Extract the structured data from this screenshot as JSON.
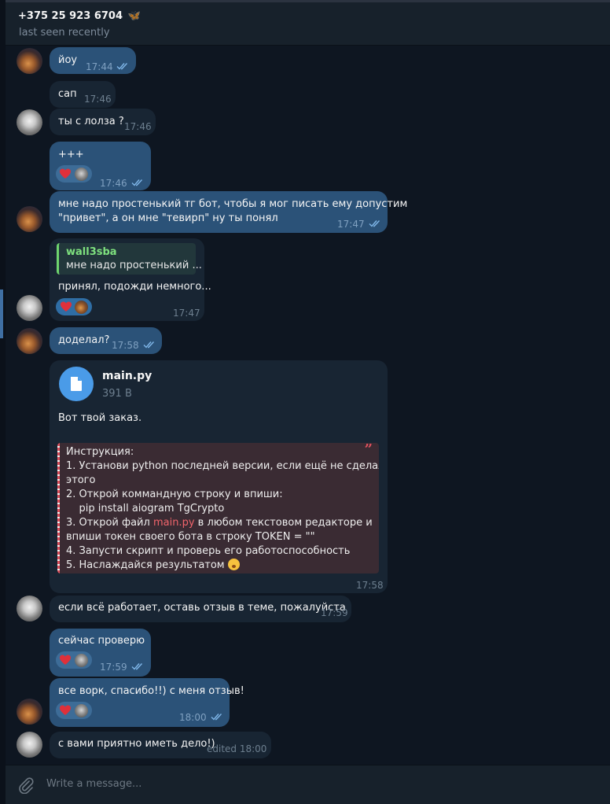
{
  "header": {
    "contact_name": "+375 25 923 6704",
    "contact_emoji": "🦋",
    "status": "last seen recently"
  },
  "messages": [
    {
      "text": "йоу",
      "time": "17:44"
    },
    {
      "text": "сап",
      "time": "17:46"
    },
    {
      "text": "ты с лолза ?",
      "time": "17:46"
    },
    {
      "text": "+++",
      "time": "17:46"
    },
    {
      "text_line1": "мне надо простенький тг бот, чтобы я мог писать ему допустим",
      "text_line2": "\"привет\", а он мне \"тевирп\" ну ты понял",
      "time": "17:47"
    },
    {
      "reply_name": "wall3sba",
      "reply_text": "мне надо простенький ...",
      "text": "принял, подожди немного...",
      "time": "17:47"
    },
    {
      "text": "доделал?",
      "time": "17:58"
    },
    {
      "file_name": "main.py",
      "file_size": "391 B",
      "caption": "Вот твой заказ.",
      "quote": {
        "line1": "Инструкция:",
        "line2": "1. Установи python последней версии, если ещё не сделал",
        "line3": "этого",
        "line4": "2. Открой коммандную строку и впиши:",
        "line5": "    pip install aiogram TgCrypto",
        "line6_pre": "3. Открой файл ",
        "line6_hl": "main.py",
        "line6_post": " в любом текстовом редакторе и",
        "line7": "впиши токен своего бота в строку TOKEN = \"\"",
        "line8": "4. Запусти скрипт и проверь его работоспособность",
        "line9": "5. Наслаждайся результатом"
      },
      "time": "17:58"
    },
    {
      "text": "если всё работает, оставь отзыв в теме, пожалуйста",
      "time": "17:59"
    },
    {
      "text": "сейчас проверю",
      "time": "17:59"
    },
    {
      "text": "все ворк, спасибо!!) с меня отзыв!",
      "time": "18:00"
    },
    {
      "text": "с вами приятно иметь дело!)",
      "time": "edited 18:00"
    }
  ],
  "input": {
    "placeholder": "Write a message..."
  },
  "icons": {
    "attach": "paperclip-icon",
    "file": "document-icon",
    "read_receipt": "double-check-icon",
    "reaction": "heart-icon",
    "quote": "quote-icon"
  },
  "colors": {
    "background": "#0e1621",
    "header": "#17212b",
    "outgoing_bubble": "#2b5278",
    "incoming_bubble": "#182533",
    "quote_accent": "#e0525f",
    "reply_accent": "#6ed46e",
    "file_icon": "#4a9be8"
  }
}
